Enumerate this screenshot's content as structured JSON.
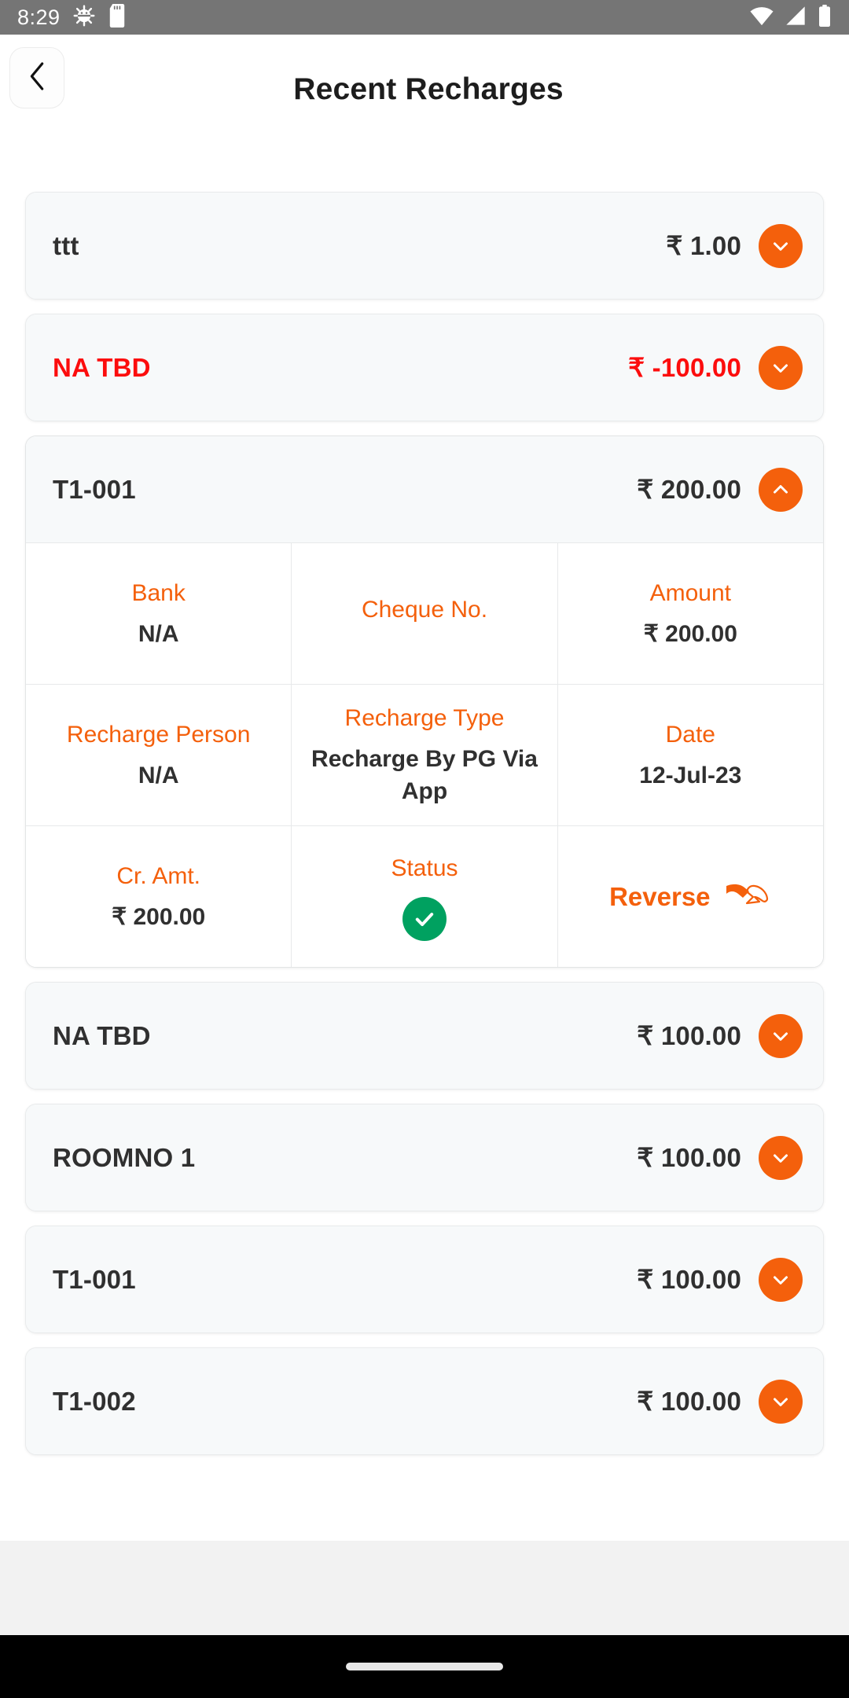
{
  "status_bar": {
    "time": "8:29",
    "icons_left": [
      "android-bug-icon",
      "sd-card-icon"
    ],
    "icons_right": [
      "wifi-icon",
      "cellular-signal-icon",
      "battery-icon"
    ],
    "background": "#757575"
  },
  "header": {
    "back_icon": "chevron-left-icon",
    "title": "Recent Recharges"
  },
  "theme": {
    "accent": "#f4600c",
    "negative": "#fc0d0d",
    "success": "#00a160",
    "text": "#303030"
  },
  "recharges": [
    {
      "name": "ttt",
      "amount": "₹ 1.00",
      "negative": false,
      "expanded": false,
      "toggle_icon": "chevron-down-icon"
    },
    {
      "name": "NA TBD",
      "amount": "₹ -100.00",
      "negative": true,
      "expanded": false,
      "toggle_icon": "chevron-down-icon"
    },
    {
      "name": "T1-001",
      "amount": "₹ 200.00",
      "negative": false,
      "expanded": true,
      "toggle_icon": "chevron-up-icon",
      "details": [
        [
          {
            "label": "Bank",
            "value": "N/A"
          },
          {
            "label": "Cheque No.",
            "value": ""
          },
          {
            "label": "Amount",
            "value": "₹ 200.00"
          }
        ],
        [
          {
            "label": "Recharge Person",
            "value": "N/A"
          },
          {
            "label": "Recharge Type",
            "value": "Recharge By PG Via App"
          },
          {
            "label": "Date",
            "value": "12-Jul-23"
          }
        ],
        [
          {
            "label": "Cr. Amt.",
            "value": "₹ 200.00"
          },
          {
            "label": "Status",
            "value": "",
            "badge": "check-circle-icon"
          },
          {
            "label": "",
            "value": "",
            "action": "Reverse",
            "action_icon": "reverse-arrows-icon"
          }
        ]
      ]
    },
    {
      "name": "NA TBD",
      "amount": "₹ 100.00",
      "negative": false,
      "expanded": false,
      "toggle_icon": "chevron-down-icon"
    },
    {
      "name": "ROOMNO 1",
      "amount": "₹ 100.00",
      "negative": false,
      "expanded": false,
      "toggle_icon": "chevron-down-icon"
    },
    {
      "name": "T1-001",
      "amount": "₹ 100.00",
      "negative": false,
      "expanded": false,
      "toggle_icon": "chevron-down-icon"
    },
    {
      "name": "T1-002",
      "amount": "₹ 100.00",
      "negative": false,
      "expanded": false,
      "toggle_icon": "chevron-down-icon"
    }
  ],
  "nav_bar": {
    "home_indicator": "home-indicator"
  }
}
